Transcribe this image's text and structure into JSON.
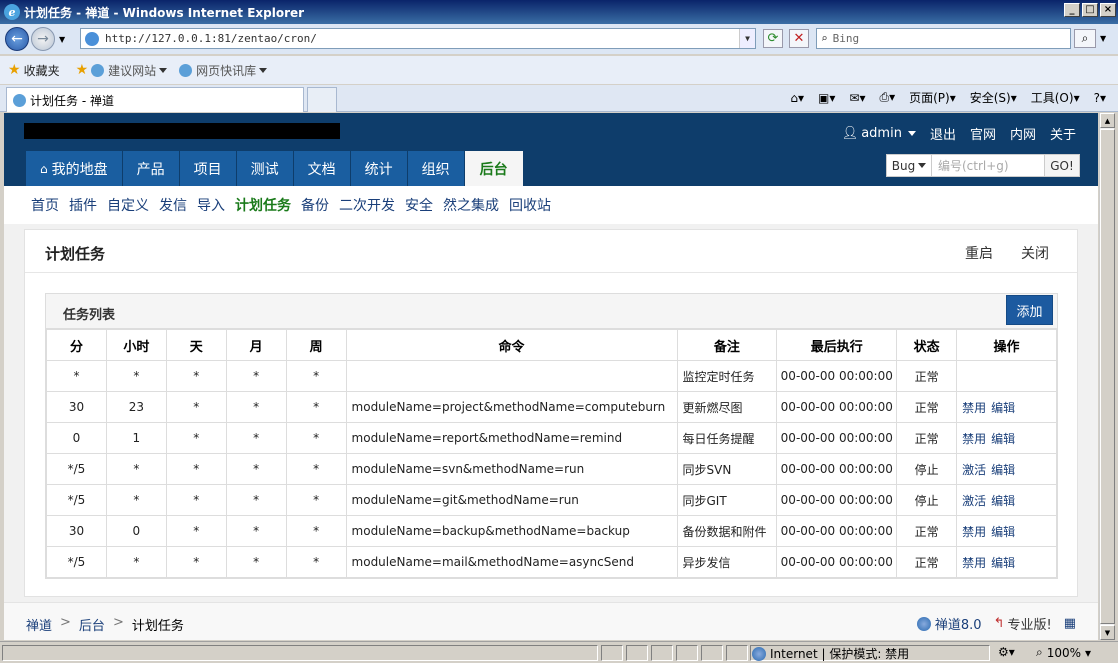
{
  "window": {
    "title": "计划任务 - 禅道 - Windows Internet Explorer",
    "min": "_",
    "max": "□",
    "close": "×"
  },
  "browser": {
    "url": "http://127.0.0.1:81/zentao/cron/",
    "search_placeholder": "Bing",
    "favorites": [
      "收藏夹",
      "建议网站",
      "网页快讯库"
    ],
    "tab_title": "计划任务 - 禅道",
    "commands": [
      "页面(P)",
      "安全(S)",
      "工具(O)"
    ]
  },
  "app": {
    "user": "admin",
    "top_links": [
      "退出",
      "官网",
      "内网",
      "关于"
    ],
    "main_nav": [
      "我的地盘",
      "产品",
      "项目",
      "测试",
      "文档",
      "统计",
      "组织",
      "后台"
    ],
    "active_main": "后台",
    "search": {
      "type": "Bug",
      "placeholder": "编号(ctrl+g)",
      "go": "GO!"
    },
    "sub_nav": [
      "首页",
      "插件",
      "自定义",
      "发信",
      "导入",
      "计划任务",
      "备份",
      "二次开发",
      "安全",
      "然之集成",
      "回收站"
    ],
    "active_sub": "计划任务"
  },
  "panel": {
    "title": "计划任务",
    "actions": [
      "重启",
      "关闭"
    ],
    "list_title": "任务列表",
    "add_label": "添加",
    "columns": [
      "分",
      "小时",
      "天",
      "月",
      "周",
      "命令",
      "备注",
      "最后执行",
      "状态",
      "操作"
    ],
    "rows": [
      [
        "*",
        "*",
        "*",
        "*",
        "*",
        "",
        "监控定时任务",
        "00-00-00 00:00:00",
        "正常",
        []
      ],
      [
        "30",
        "23",
        "*",
        "*",
        "*",
        "moduleName=project&methodName=computeburn",
        "更新燃尽图",
        "00-00-00 00:00:00",
        "正常",
        [
          "禁用",
          "编辑"
        ]
      ],
      [
        "0",
        "1",
        "*",
        "*",
        "*",
        "moduleName=report&methodName=remind",
        "每日任务提醒",
        "00-00-00 00:00:00",
        "正常",
        [
          "禁用",
          "编辑"
        ]
      ],
      [
        "*/5",
        "*",
        "*",
        "*",
        "*",
        "moduleName=svn&methodName=run",
        "同步SVN",
        "00-00-00 00:00:00",
        "停止",
        [
          "激活",
          "编辑"
        ]
      ],
      [
        "*/5",
        "*",
        "*",
        "*",
        "*",
        "moduleName=git&methodName=run",
        "同步GIT",
        "00-00-00 00:00:00",
        "停止",
        [
          "激活",
          "编辑"
        ]
      ],
      [
        "30",
        "0",
        "*",
        "*",
        "*",
        "moduleName=backup&methodName=backup",
        "备份数据和附件",
        "00-00-00 00:00:00",
        "正常",
        [
          "禁用",
          "编辑"
        ]
      ],
      [
        "*/5",
        "*",
        "*",
        "*",
        "*",
        "moduleName=mail&methodName=asyncSend",
        "异步发信",
        "00-00-00 00:00:00",
        "正常",
        [
          "禁用",
          "编辑"
        ]
      ]
    ]
  },
  "footer": {
    "breadcrumbs": [
      "禅道",
      "后台",
      "计划任务"
    ],
    "sep": ">",
    "version": "禅道8.0",
    "pro": "专业版!"
  },
  "statusbar": {
    "zone": "Internet | 保护模式: 禁用",
    "zoom": "100%"
  },
  "colors": {
    "header": "#0e3d6b",
    "nav_item": "#1a5ea0",
    "active": "#1a7a1a",
    "link": "#1a3f7a",
    "add_btn": "#1c5aa0"
  }
}
